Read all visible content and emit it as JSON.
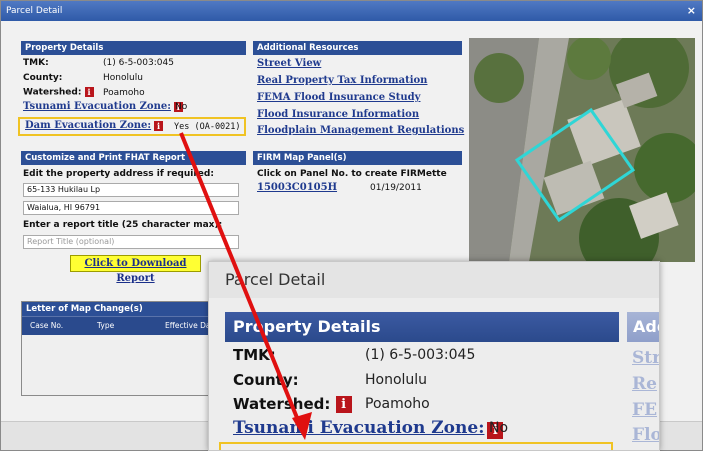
{
  "window": {
    "title": "Parcel Detail",
    "close_glyph": "×"
  },
  "property_details": {
    "header": "Property Details",
    "tmk_label": "TMK:",
    "tmk_value": "(1) 6-5-003:045",
    "county_label": "County:",
    "county_value": "Honolulu",
    "watershed_label": "Watershed:",
    "watershed_value": "Poamoho",
    "tsunami_label": "Tsunami Evacuation Zone:",
    "tsunami_value": "No",
    "dam_label": "Dam Evacuation Zone:",
    "dam_value": "Yes (OA-0021)",
    "info_glyph": "i"
  },
  "additional_resources": {
    "header": "Additional Resources",
    "links": [
      "Street View",
      "Real Property Tax Information",
      "FEMA Flood Insurance Study",
      "Flood Insurance Information",
      "Floodplain Management Regulations"
    ]
  },
  "report": {
    "header": "Customize and Print FHAT Report",
    "edit_label": "Edit the property address if required:",
    "address_line1": "65-133 Hukilau Lp",
    "address_line2": "Waialua, HI  96791",
    "title_label": "Enter a report title (25 character max):",
    "title_placeholder": "Report Title (optional)",
    "download_label": "Click to Download Report"
  },
  "firm": {
    "header": "FIRM Map Panel(s)",
    "instruction": "Click on Panel No. to create FIRMette",
    "panel_no": "15003C0105H",
    "panel_date": "01/19/2011"
  },
  "lomc": {
    "header": "Letter of Map Change(s)",
    "columns": [
      "Case No.",
      "Type",
      "Effective Da"
    ]
  },
  "zoom": {
    "title": "Parcel Detail",
    "header": "Property Details",
    "header2_partial": "Add",
    "header2_tail": "d",
    "tmk_label": "TMK:",
    "tmk_value": "(1) 6-5-003:045",
    "county_label": "County:",
    "county_value": "Honolulu",
    "watershed_label": "Watershed:",
    "watershed_value": "Poamoho",
    "tsunami_label": "Tsunami Evacuation Zone:",
    "tsunami_value": "No",
    "dam_label_partial": "Dam Evacuation Zone:",
    "dam_value_partial": "Yes (OA-0021)",
    "right_links_partial": [
      "Str",
      "Re",
      "FE",
      "Flo"
    ]
  },
  "colors": {
    "section_header": "#2c4f96",
    "highlight_box": "#f0c323",
    "arrow": "#e01010",
    "parcel_outline": "#2fd6d6",
    "download_bg": "#ffff33"
  }
}
